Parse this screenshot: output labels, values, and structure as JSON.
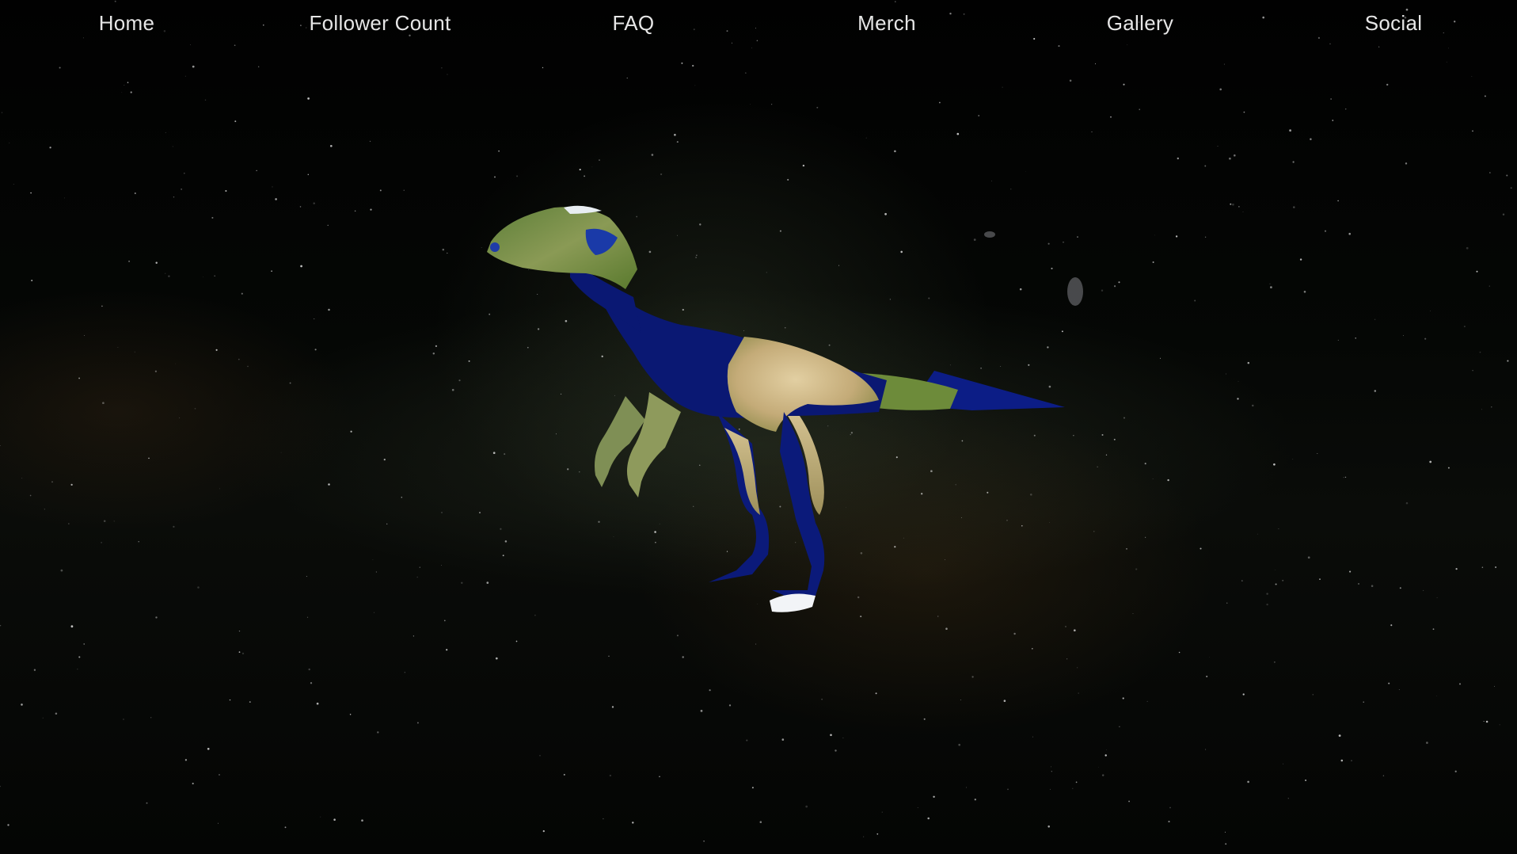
{
  "nav": {
    "items": [
      {
        "label": "Home"
      },
      {
        "label": "Follower Count"
      },
      {
        "label": "FAQ"
      },
      {
        "label": "Merch"
      },
      {
        "label": "Gallery"
      },
      {
        "label": "Social"
      }
    ]
  },
  "scene": {
    "subject": "raptor-3d-model-earth-texture",
    "colors": {
      "ocean": "#0a1a6e",
      "land_green": "#6f8a3c",
      "land_desert": "#c9b58a",
      "ice": "#f2f4f7",
      "space": "#020302"
    }
  }
}
